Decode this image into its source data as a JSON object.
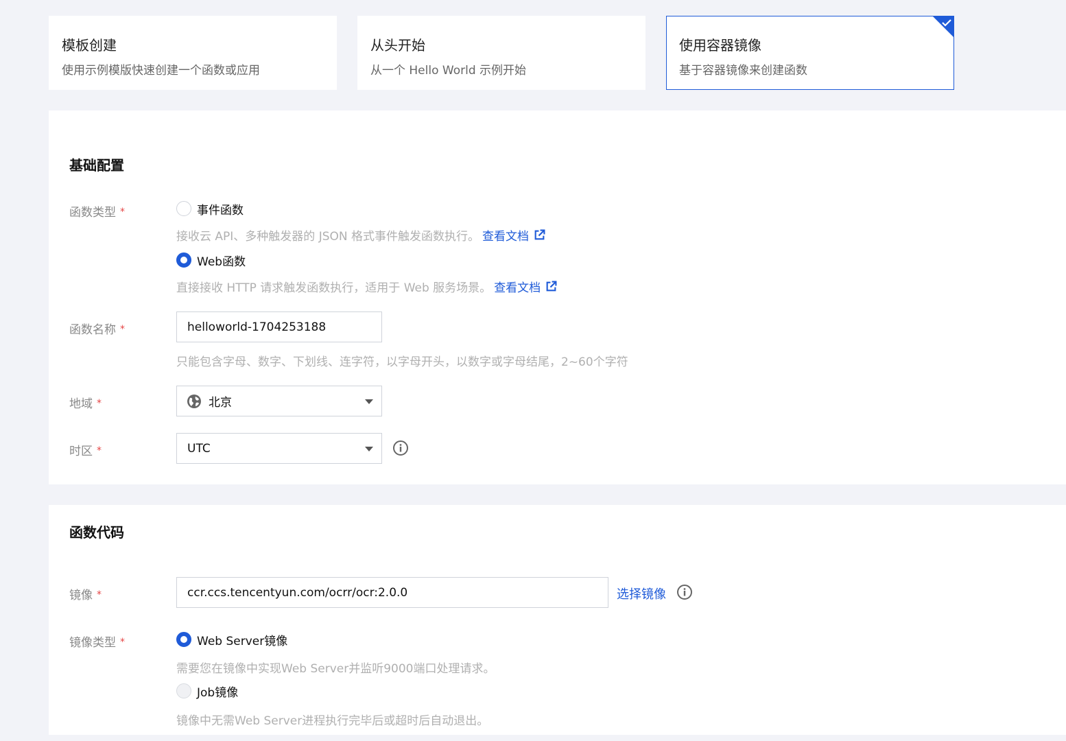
{
  "cards": [
    {
      "title": "模板创建",
      "desc": "使用示例模版快速创建一个函数或应用",
      "selected": false
    },
    {
      "title": "从头开始",
      "desc": "从一个 Hello World 示例开始",
      "selected": false
    },
    {
      "title": "使用容器镜像",
      "desc": "基于容器镜像来创建函数",
      "selected": true
    }
  ],
  "basic": {
    "title": "基础配置",
    "func_type": {
      "label": "函数类型",
      "required_mark": "*",
      "options": [
        {
          "label": "事件函数",
          "help": "接收云 API、多种触发器的 JSON 格式事件触发函数执行。",
          "link": "查看文档",
          "checked": false
        },
        {
          "label": "Web函数",
          "help": "直接接收 HTTP 请求触发函数执行，适用于 Web 服务场景。",
          "link": "查看文档",
          "checked": true
        }
      ]
    },
    "func_name": {
      "label": "函数名称",
      "required_mark": "*",
      "value": "helloworld-1704253188",
      "help": "只能包含字母、数字、下划线、连字符，以字母开头，以数字或字母结尾，2~60个字符"
    },
    "region": {
      "label": "地域",
      "required_mark": "*",
      "value": "北京"
    },
    "timezone": {
      "label": "时区",
      "required_mark": "*",
      "value": "UTC"
    }
  },
  "code": {
    "title": "函数代码",
    "image": {
      "label": "镜像",
      "required_mark": "*",
      "value": "ccr.ccs.tencentyun.com/ocrr/ocr:2.0.0",
      "select_link": "选择镜像"
    },
    "image_type": {
      "label": "镜像类型",
      "required_mark": "*",
      "options": [
        {
          "label": "Web Server镜像",
          "help": "需要您在镜像中实现Web Server并监听9000端口处理请求。",
          "checked": true
        },
        {
          "label": "Job镜像",
          "help": "镜像中无需Web Server进程执行完毕后或超时后自动退出。",
          "checked": false,
          "disabled": true
        }
      ]
    }
  },
  "colors": {
    "accent": "#1f5bd8",
    "required": "#e54545",
    "page_bg": "#f2f3f8"
  }
}
